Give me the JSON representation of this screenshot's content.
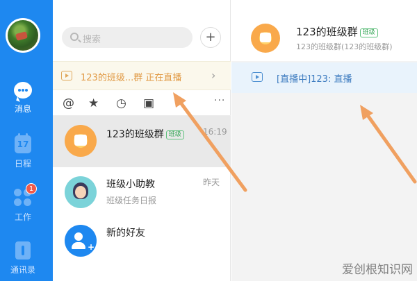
{
  "nav": {
    "items": [
      {
        "label": "消息",
        "icon": "message-bubble-icon"
      },
      {
        "label": "日程",
        "icon": "calendar-icon",
        "icon_text": "17"
      },
      {
        "label": "工作",
        "icon": "apps-grid-icon",
        "badge": "1"
      },
      {
        "label": "通讯录",
        "icon": "contacts-icon"
      }
    ]
  },
  "list": {
    "search_placeholder": "搜索",
    "add_label": "+",
    "live_banner": "123的班级...群 正在直播",
    "live_chevron": "›",
    "filter_icons": [
      "@",
      "★",
      "◷",
      "▣"
    ],
    "more": "···",
    "items": [
      {
        "name": "123的班级群",
        "tag": "班级",
        "time": "16:19",
        "sub": ""
      },
      {
        "name": "班级小助教",
        "tag": "",
        "time": "昨天",
        "sub": "班级任务日报"
      },
      {
        "name": "新的好友",
        "tag": "",
        "time": "",
        "sub": ""
      }
    ]
  },
  "chat": {
    "title": "123的班级群",
    "tag": "班级",
    "subtitle": "123的班级群(123的班级群)",
    "live_text": "[直播中]123: 直播"
  },
  "watermark": "爱创根知识网",
  "colors": {
    "nav_blue": "#1e88f0",
    "live_orange": "#e19a45",
    "annotation_arrow": "#f0a060",
    "badge_red": "#f05a4a"
  }
}
